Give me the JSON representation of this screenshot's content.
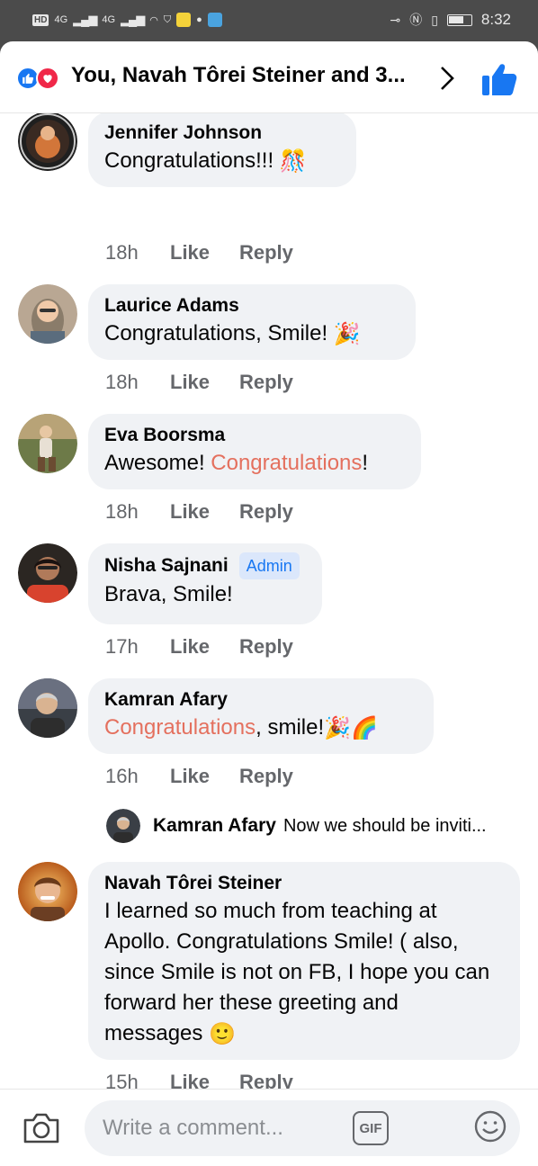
{
  "status_bar": {
    "left_chip": "HD",
    "net1": "4G",
    "net2": "4G",
    "time": "8:32"
  },
  "header": {
    "title": "You, Navah Tôrei Steiner and 3...",
    "reaction_icons": [
      "like-reaction-icon",
      "love-reaction-icon"
    ]
  },
  "comments": [
    {
      "name": "Jennifer Johnson",
      "text_parts": [
        "Congratulations!!! "
      ],
      "emoji": "🎊",
      "time": "18h",
      "like": "Like",
      "reply": "Reply"
    },
    {
      "name": "Laurice Adams",
      "text_parts": [
        "Congratulations, Smile! "
      ],
      "emoji": "🎉",
      "time": "18h",
      "like": "Like",
      "reply": "Reply"
    },
    {
      "name": "Eva Boorsma",
      "text_before": "Awesome! ",
      "highlight": "Congratulations",
      "text_after": "!",
      "time": "18h",
      "like": "Like",
      "reply": "Reply"
    },
    {
      "name": "Nisha Sajnani",
      "badge": "Admin",
      "text": "Brava, Smile!",
      "time": "17h",
      "like": "Like",
      "reply": "Reply"
    },
    {
      "name": "Kamran Afary",
      "highlight": "Congratulations",
      "text_after": ", smile!",
      "emoji": "🎉🌈",
      "time": "16h",
      "like": "Like",
      "reply": "Reply"
    },
    {
      "name": "Navah Tôrei Steiner",
      "text": "I learned so much from teaching at Apollo. Congratulations Smile! ( also, since Smile is not on FB, I hope you can forward her these greeting and messages ",
      "emoji": "🙂",
      "time": "15h",
      "like": "Like",
      "reply": "Reply"
    }
  ],
  "reply_preview": {
    "name": "Kamran Afary",
    "text": "Now we should be inviti..."
  },
  "composer": {
    "placeholder": "Write a comment...",
    "gif_label": "GIF"
  },
  "colors": {
    "accent": "#1877f2",
    "love": "#f02849",
    "highlight": "#e4705e",
    "bubble": "#f0f2f5",
    "meta": "#65676b"
  }
}
